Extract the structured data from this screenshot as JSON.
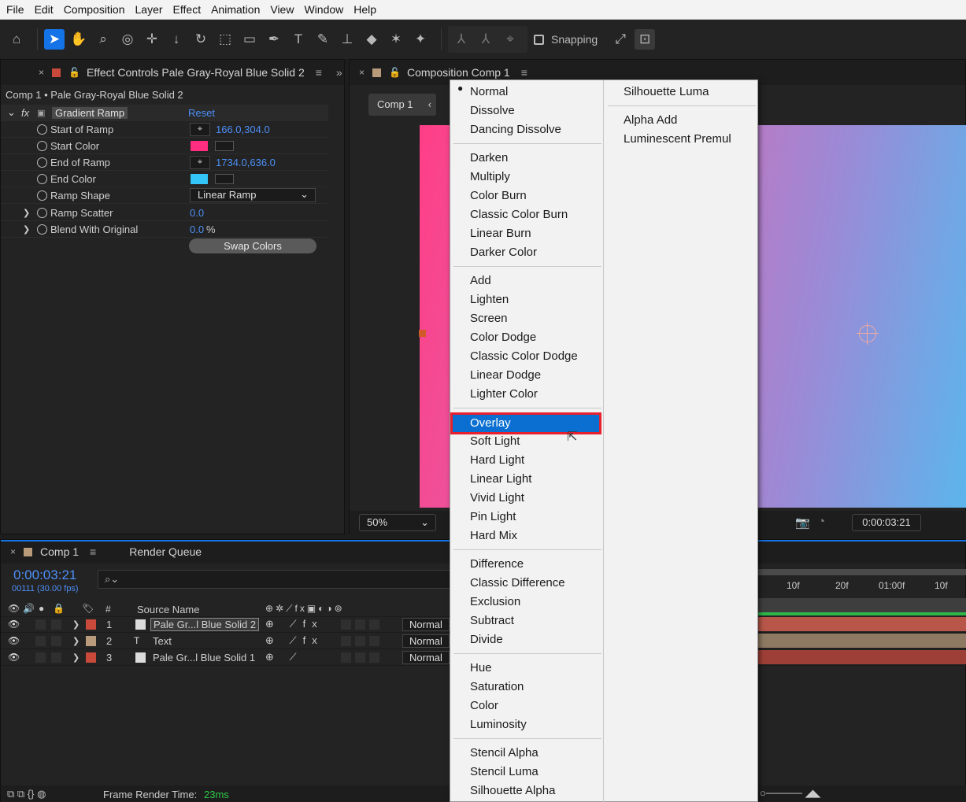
{
  "menubar": {
    "items": [
      "File",
      "Edit",
      "Composition",
      "Layer",
      "Effect",
      "Animation",
      "View",
      "Window",
      "Help"
    ]
  },
  "toolbar": {
    "snapping_label": "Snapping"
  },
  "effect_controls": {
    "tab_title": "Effect Controls Pale Gray-Royal Blue Solid 2",
    "subtitle": "Comp 1 • Pale Gray-Royal Blue Solid 2",
    "effect_name": "Gradient Ramp",
    "reset_label": "Reset",
    "props": {
      "start_of_ramp": {
        "label": "Start of Ramp",
        "value": "166.0,304.0"
      },
      "start_color": {
        "label": "Start Color",
        "color": "#ff2e80"
      },
      "end_of_ramp": {
        "label": "End of Ramp",
        "value": "1734.0,636.0"
      },
      "end_color": {
        "label": "End Color",
        "color": "#33c5f7"
      },
      "ramp_shape": {
        "label": "Ramp Shape",
        "value": "Linear Ramp"
      },
      "ramp_scatter": {
        "label": "Ramp Scatter",
        "value": "0.0"
      },
      "blend_with_original": {
        "label": "Blend With Original",
        "value": "0.0",
        "unit": "%"
      }
    },
    "swap_label": "Swap Colors"
  },
  "composition": {
    "tab_title": "Composition Comp 1",
    "subtab": "Comp 1",
    "zoom": "50%",
    "timecode": "0:00:03:21"
  },
  "timeline": {
    "tab_comp": "Comp 1",
    "tab_render": "Render Queue",
    "timecode": "0:00:03:21",
    "frame_info": "00111 (30.00 fps)",
    "col_number": "#",
    "col_source": "Source Name",
    "ruler": [
      "10f",
      "20f",
      "01:00f",
      "10f"
    ],
    "layers": [
      {
        "num": "1",
        "name": "Pale Gr...l Blue Solid 2",
        "mode": "Normal",
        "color": "#c94a3a"
      },
      {
        "num": "2",
        "name": "Text",
        "mode": "Normal",
        "color": "#b99a7a"
      },
      {
        "num": "3",
        "name": "Pale Gr...l Blue Solid 1",
        "mode": "Normal",
        "color": "#c94a3a"
      }
    ],
    "frame_render_label": "Frame Render Time:",
    "frame_render_value": "23ms"
  },
  "blend_menu": {
    "col1_groups": [
      [
        "Normal",
        "Dissolve",
        "Dancing Dissolve"
      ],
      [
        "Darken",
        "Multiply",
        "Color Burn",
        "Classic Color Burn",
        "Linear Burn",
        "Darker Color"
      ],
      [
        "Add",
        "Lighten",
        "Screen",
        "Color Dodge",
        "Classic Color Dodge",
        "Linear Dodge",
        "Lighter Color"
      ],
      [
        "Overlay",
        "Soft Light",
        "Hard Light",
        "Linear Light",
        "Vivid Light",
        "Pin Light",
        "Hard Mix"
      ],
      [
        "Difference",
        "Classic Difference",
        "Exclusion",
        "Subtract",
        "Divide"
      ],
      [
        "Hue",
        "Saturation",
        "Color",
        "Luminosity"
      ],
      [
        "Stencil Alpha",
        "Stencil Luma",
        "Silhouette Alpha"
      ]
    ],
    "col2_groups": [
      [
        "Silhouette Luma"
      ],
      [
        "Alpha Add",
        "Luminescent Premul"
      ]
    ],
    "current": "Normal",
    "highlighted": "Overlay"
  }
}
